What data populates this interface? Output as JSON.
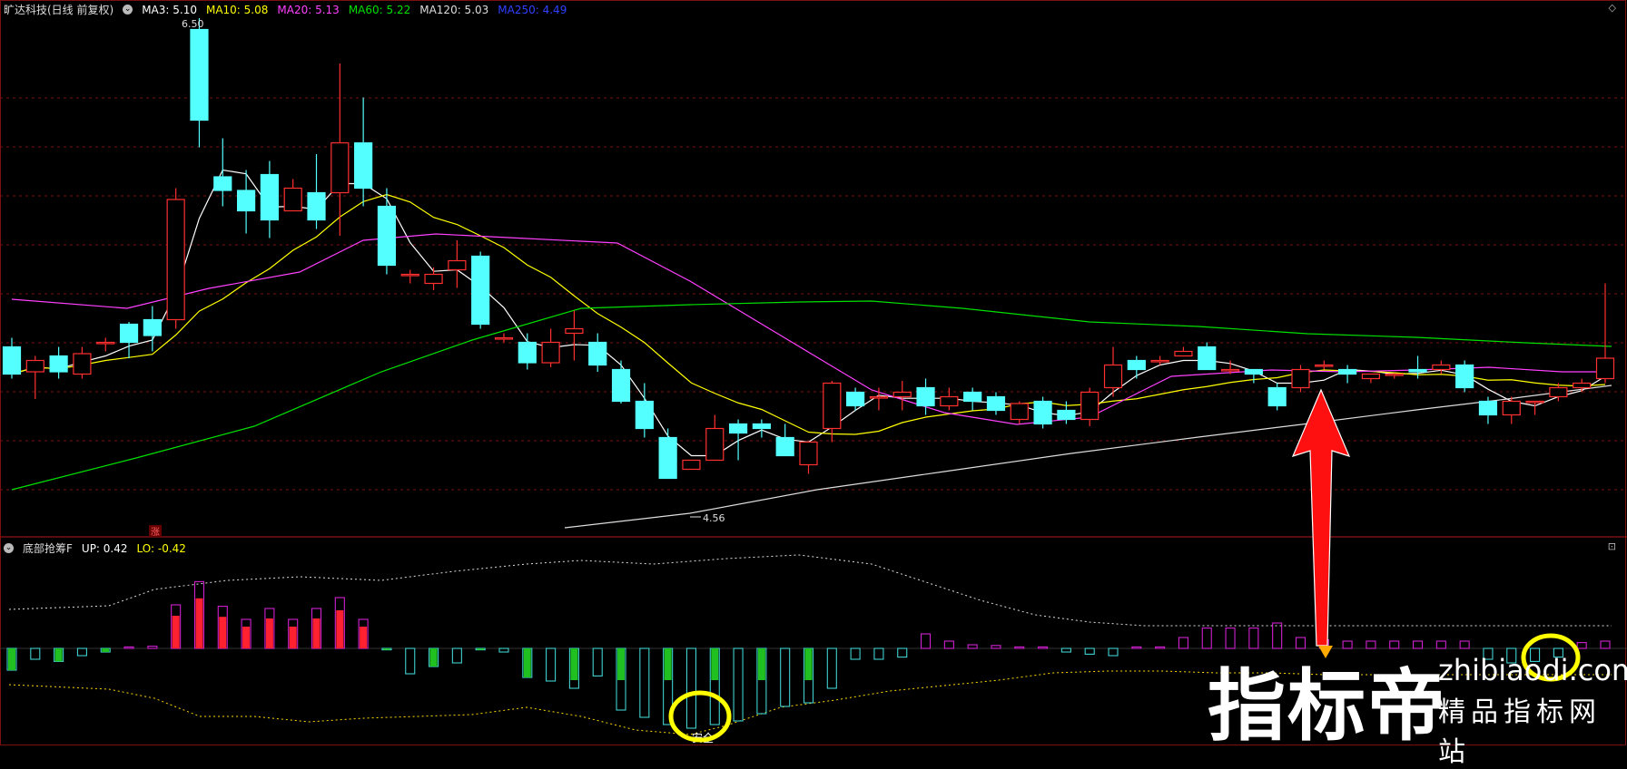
{
  "main_header": {
    "title": "旷达科技(日线 前复权)",
    "ma": [
      {
        "label": "MA3: 5.10",
        "color": "#ffffff"
      },
      {
        "label": "MA10: 5.08",
        "color": "#ffff00"
      },
      {
        "label": "MA20: 5.13",
        "color": "#ff40ff"
      },
      {
        "label": "MA60: 5.22",
        "color": "#00e000"
      },
      {
        "label": "MA120: 5.03",
        "color": "#dddddd"
      },
      {
        "label": "MA250: 4.49",
        "color": "#3040ff"
      }
    ]
  },
  "annotations": {
    "high_label": "6.50",
    "low_label": "4.56",
    "zhang_tag": "涨",
    "safe_label": "安全"
  },
  "indicator_header": {
    "name": "底部抢筹F",
    "up": "UP: 0.42",
    "lo": "LO: -0.42"
  },
  "watermark": {
    "main": "指标帝",
    "url": "zhibiaodi.com",
    "sub": "精品指标网站"
  },
  "colors": {
    "up_candle": "#ff3030",
    "down_candle": "#54ffff",
    "grid": "#7a1010",
    "ma3": "#ffffff",
    "ma10": "#ffff00",
    "ma20": "#ff40ff",
    "ma60": "#00e000",
    "ma120": "#dddddd"
  },
  "chart_data": {
    "type": "candlestick",
    "candles": [
      [
        5.1,
        4.98,
        5.14,
        4.96
      ],
      [
        4.99,
        5.04,
        5.06,
        4.87
      ],
      [
        5.06,
        4.99,
        5.1,
        4.96
      ],
      [
        4.98,
        5.07,
        5.1,
        4.96
      ],
      [
        5.12,
        5.12,
        5.14,
        5.08
      ],
      [
        5.2,
        5.12,
        5.21,
        5.05
      ],
      [
        5.22,
        5.15,
        5.28,
        5.08
      ],
      [
        5.22,
        5.75,
        5.8,
        5.18
      ],
      [
        6.5,
        6.1,
        6.55,
        5.98
      ],
      [
        5.85,
        5.79,
        6.02,
        5.72
      ],
      [
        5.79,
        5.7,
        5.88,
        5.6
      ],
      [
        5.86,
        5.66,
        5.92,
        5.58
      ],
      [
        5.7,
        5.8,
        5.84,
        5.7
      ],
      [
        5.78,
        5.66,
        5.95,
        5.62
      ],
      [
        5.78,
        6.0,
        6.35,
        5.59
      ],
      [
        6.0,
        5.8,
        6.2,
        5.72
      ],
      [
        5.72,
        5.46,
        5.8,
        5.42
      ],
      [
        5.42,
        5.42,
        5.44,
        5.38
      ],
      [
        5.38,
        5.42,
        5.45,
        5.35
      ],
      [
        5.44,
        5.48,
        5.57,
        5.36
      ],
      [
        5.5,
        5.2,
        5.52,
        5.18
      ],
      [
        5.14,
        5.14,
        5.16,
        5.12
      ],
      [
        5.12,
        5.03,
        5.16,
        5.0
      ],
      [
        5.03,
        5.12,
        5.18,
        5.01
      ],
      [
        5.16,
        5.18,
        5.26,
        5.04
      ],
      [
        5.12,
        5.02,
        5.16,
        4.99
      ],
      [
        5.0,
        4.86,
        5.04,
        4.85
      ],
      [
        4.86,
        4.74,
        4.94,
        4.7
      ],
      [
        4.7,
        4.52,
        4.74,
        4.52
      ],
      [
        4.56,
        4.6,
        4.56,
        4.56
      ],
      [
        4.6,
        4.74,
        4.8,
        4.6
      ],
      [
        4.76,
        4.72,
        4.78,
        4.6
      ],
      [
        4.76,
        4.74,
        4.78,
        4.7
      ],
      [
        4.7,
        4.62,
        4.76,
        4.62
      ],
      [
        4.58,
        4.68,
        4.64,
        4.54
      ],
      [
        4.74,
        4.94,
        4.95,
        4.68
      ],
      [
        4.9,
        4.84,
        4.92,
        4.82
      ],
      [
        4.88,
        4.88,
        4.92,
        4.82
      ],
      [
        4.88,
        4.9,
        4.95,
        4.82
      ],
      [
        4.92,
        4.84,
        4.96,
        4.8
      ],
      [
        4.84,
        4.88,
        4.92,
        4.82
      ],
      [
        4.9,
        4.86,
        4.92,
        4.82
      ],
      [
        4.88,
        4.82,
        4.9,
        4.8
      ],
      [
        4.78,
        4.85,
        4.86,
        4.76
      ],
      [
        4.86,
        4.76,
        4.88,
        4.74
      ],
      [
        4.82,
        4.78,
        4.86,
        4.76
      ],
      [
        4.78,
        4.9,
        4.92,
        4.75
      ],
      [
        4.92,
        5.02,
        5.1,
        4.88
      ],
      [
        5.04,
        5.0,
        5.06,
        4.96
      ],
      [
        5.04,
        5.04,
        5.06,
        5.02
      ],
      [
        5.06,
        5.08,
        5.1,
        5.06
      ],
      [
        5.1,
        5.0,
        5.12,
        5.0
      ],
      [
        5.0,
        5.0,
        5.04,
        4.98
      ],
      [
        5.0,
        4.98,
        5.0,
        4.94
      ],
      [
        4.92,
        4.84,
        4.94,
        4.82
      ],
      [
        4.92,
        5.0,
        5.02,
        4.9
      ],
      [
        5.02,
        5.02,
        5.04,
        5.0
      ],
      [
        5.0,
        4.98,
        5.02,
        4.94
      ],
      [
        4.96,
        4.98,
        4.98,
        4.94
      ],
      [
        4.98,
        4.98,
        4.98,
        4.96
      ],
      [
        5.0,
        4.99,
        5.06,
        4.96
      ],
      [
        5.0,
        5.02,
        5.04,
        4.98
      ],
      [
        5.02,
        4.92,
        5.04,
        4.9
      ],
      [
        4.86,
        4.8,
        4.88,
        4.76
      ],
      [
        4.8,
        4.86,
        4.88,
        4.76
      ],
      [
        4.86,
        4.86,
        4.86,
        4.8
      ],
      [
        4.88,
        4.92,
        4.94,
        4.86
      ],
      [
        4.92,
        4.94,
        4.96,
        4.9
      ],
      [
        4.96,
        5.05,
        5.38,
        4.94
      ]
    ]
  }
}
